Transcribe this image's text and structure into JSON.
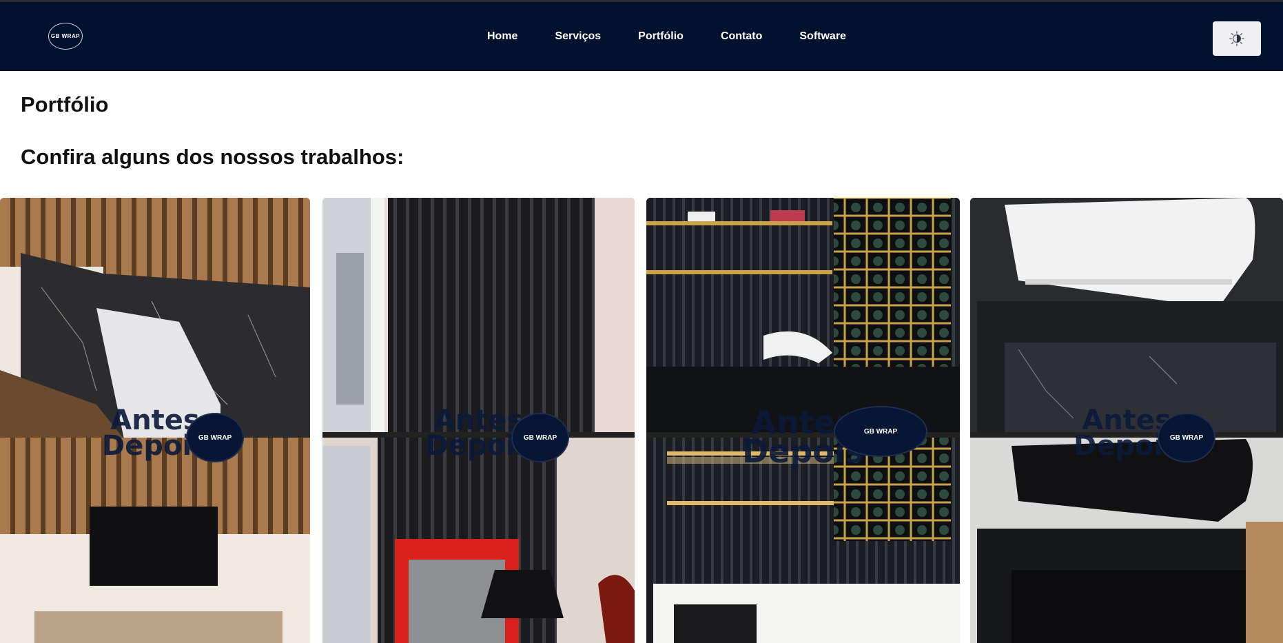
{
  "nav": {
    "logo_text": "GB WRAP",
    "links": [
      "Home",
      "Serviços",
      "Portfólio",
      "Contato",
      "Software"
    ],
    "theme_icon": "theme-toggle-icon"
  },
  "page": {
    "title": "Portfólio",
    "subtitle": "Confira alguns dos nossos trabalhos:"
  },
  "portfolio": {
    "items": [
      {
        "before": "Antes",
        "after": "Depois",
        "badge": "GB WRAP"
      },
      {
        "before": "Antes",
        "after": "Depois",
        "badge": "GB WRAP"
      },
      {
        "before": "Antes",
        "after": "Depois",
        "badge": "GB WRAP"
      },
      {
        "before": "Antes",
        "after": "Depois",
        "badge": "GB WRAP"
      }
    ]
  },
  "colors": {
    "navbar": "#01112e",
    "badge": "#061634",
    "label": "#0b1a3a"
  }
}
